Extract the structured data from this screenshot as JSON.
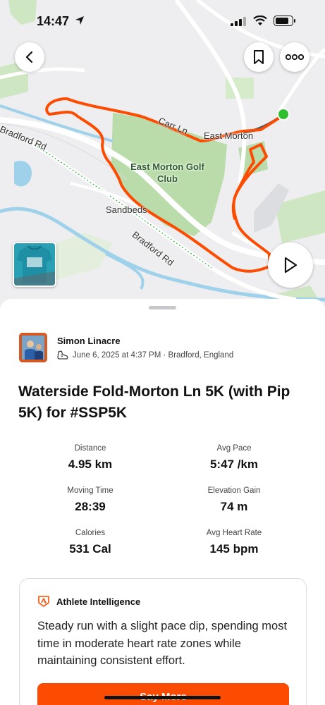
{
  "status_bar": {
    "time": "14:47",
    "icons": [
      "location-arrow-icon",
      "signal-icon",
      "wifi-icon",
      "battery-icon"
    ]
  },
  "map": {
    "labels": {
      "carr_ln": "Carr Ln",
      "east_morton": "East Morton",
      "golf_club_line1": "East Morton Golf",
      "golf_club_line2": "Club",
      "sandbeds": "Sandbeds",
      "bradford_rd_top": "Bradford Rd",
      "bradford_rd_bottom": "Bradford Rd"
    },
    "route_color": "#fc4c02",
    "start_color": "#2ec02e"
  },
  "header_buttons": {
    "back": "chevron-left-icon",
    "bookmark": "bookmark-icon",
    "more": "more-icon",
    "play": "play-icon"
  },
  "athlete": {
    "name": "Simon Linacre",
    "meta": "June 6, 2025 at 4:37 PM · Bradford, England"
  },
  "activity": {
    "title": "Waterside Fold-Morton Ln 5K (with Pip 5K) for #SSP5K"
  },
  "stats": {
    "distance_label": "Distance",
    "distance_value": "4.95 km",
    "pace_label": "Avg Pace",
    "pace_value": "5:47 /km",
    "moving_label": "Moving Time",
    "moving_value": "28:39",
    "elevation_label": "Elevation Gain",
    "elevation_value": "74 m",
    "calories_label": "Calories",
    "calories_value": "531 Cal",
    "hr_label": "Avg Heart Rate",
    "hr_value": "145 bpm"
  },
  "athlete_intelligence": {
    "label": "Athlete Intelligence",
    "text": "Steady run with a slight pace dip, spending most time in moderate heart rate zones while maintaining consistent effort.",
    "button": "Say More"
  },
  "colors": {
    "accent": "#fc4c02",
    "park_green": "#b9dcaa",
    "water": "#8fcbe8"
  }
}
